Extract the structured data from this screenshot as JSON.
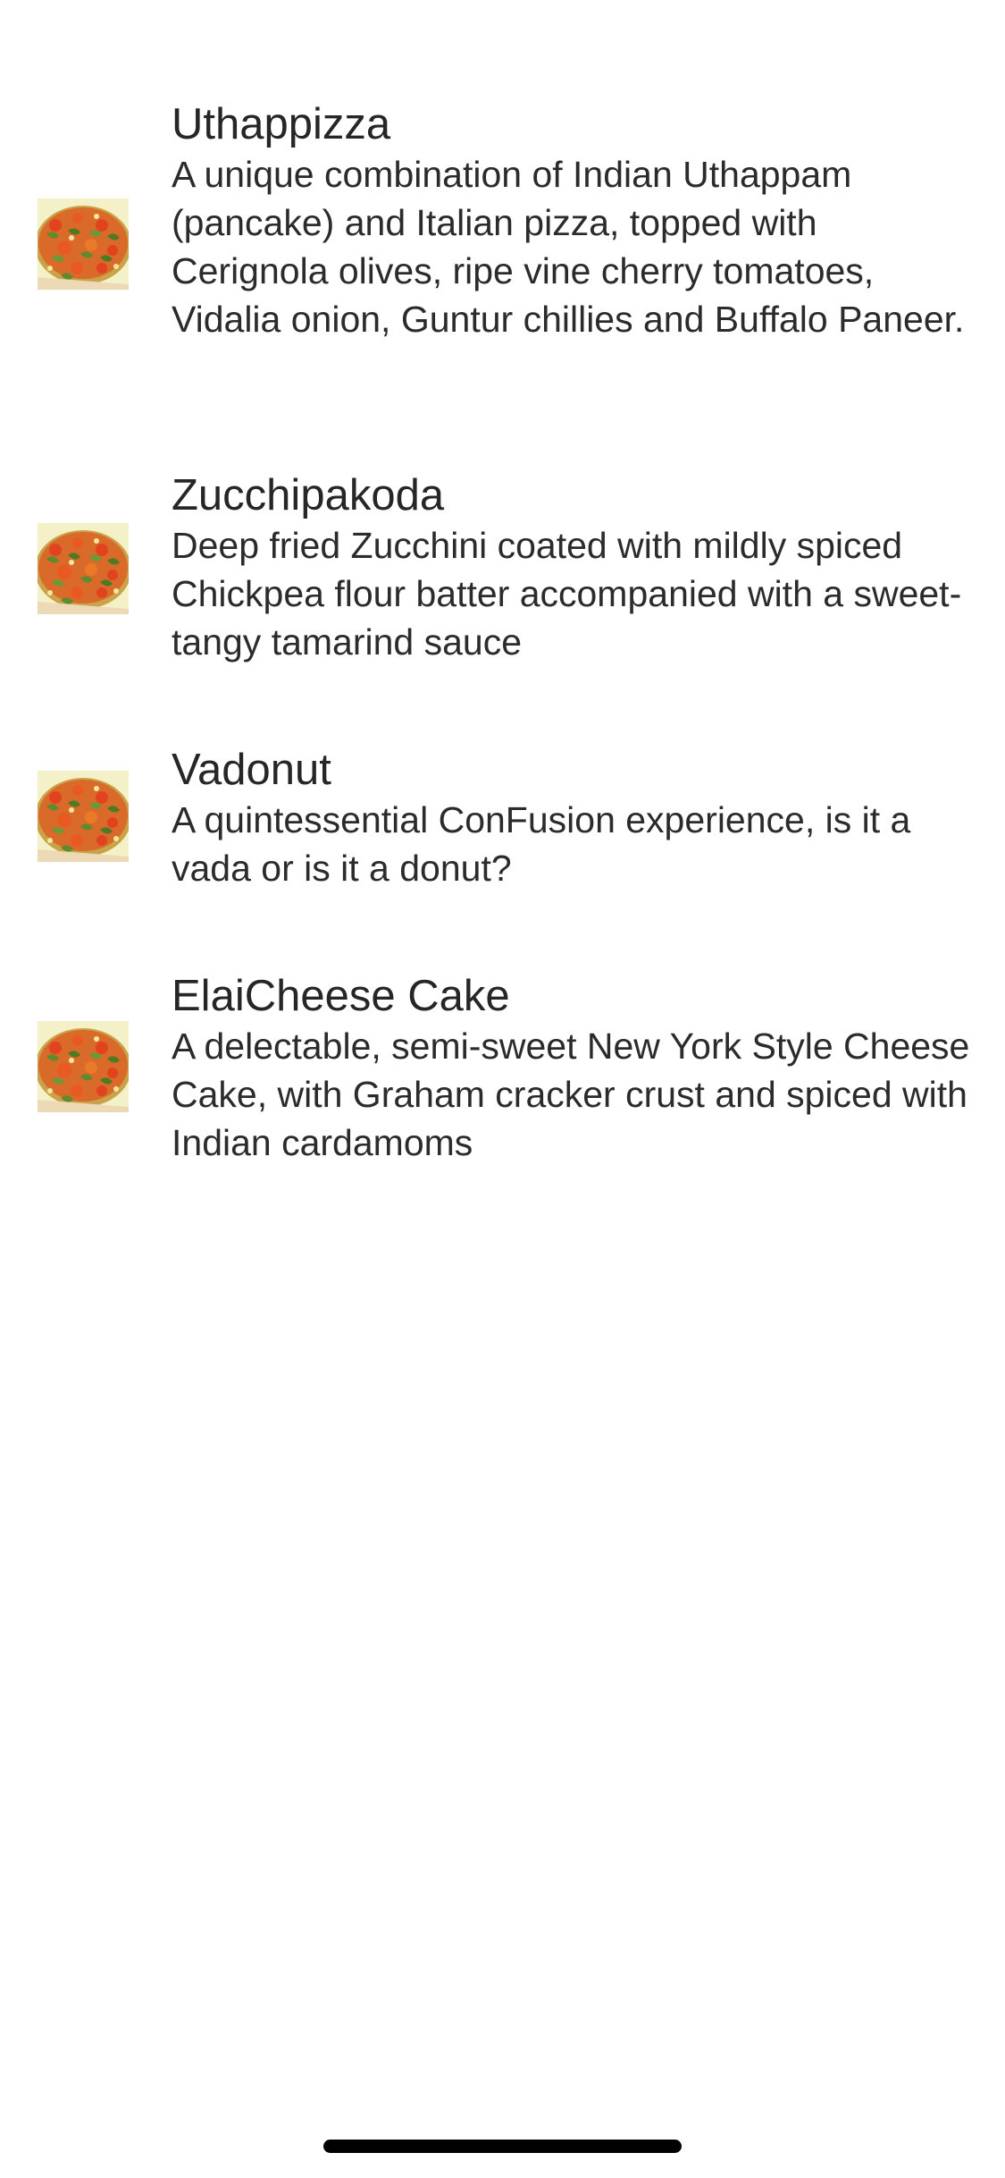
{
  "menu": {
    "items": [
      {
        "name": "Uthappizza",
        "description": "A unique combination of Indian Uthappam (pancake) and Italian pizza, topped with Cerignola olives, ripe vine cherry tomatoes, Vidalia onion, Guntur chillies and Buffalo Paneer.",
        "image_icon": "pizza-thumbnail"
      },
      {
        "name": "Zucchipakoda",
        "description": "Deep fried Zucchini coated with mildly spiced Chickpea flour batter accompanied with a sweet-tangy tamarind sauce",
        "image_icon": "pizza-thumbnail"
      },
      {
        "name": "Vadonut",
        "description": "A quintessential ConFusion experience, is it a vada or is it a donut?",
        "image_icon": "pizza-thumbnail"
      },
      {
        "name": "ElaiCheese Cake",
        "description": "A delectable, semi-sweet New York Style Cheese Cake, with Graham cracker crust and spiced with Indian cardamoms",
        "image_icon": "pizza-thumbnail"
      }
    ]
  },
  "colors": {
    "background": "#ffffff",
    "text": "#222222",
    "home_indicator": "#000000"
  }
}
